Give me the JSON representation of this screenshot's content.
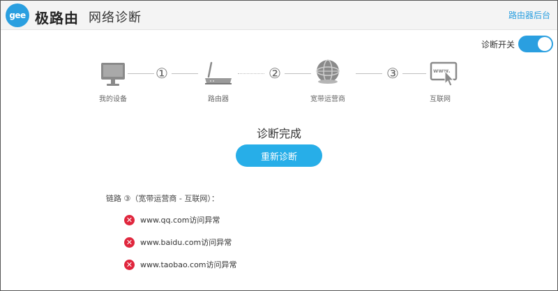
{
  "header": {
    "logo_text": "gee",
    "brand": "极路由",
    "title": "网络诊断",
    "admin_link": "路由器后台"
  },
  "toggle": {
    "label": "诊断开关",
    "on": true
  },
  "steps": [
    {
      "label": "我的设备",
      "icon": "monitor-icon"
    },
    {
      "label": "路由器",
      "icon": "router-icon"
    },
    {
      "label": "宽带运营商",
      "icon": "globe-icon"
    },
    {
      "label": "互联网",
      "icon": "www-icon"
    }
  ],
  "step_numbers": [
    "①",
    "②",
    "③"
  ],
  "status": {
    "title": "诊断完成",
    "redo_button": "重新诊断"
  },
  "link_summary": "链路 ③（宽带运营商 - 互联网）：",
  "results": [
    {
      "text": "www.qq.com访问异常",
      "status": "error"
    },
    {
      "text": "www.baidu.com访问异常",
      "status": "error"
    },
    {
      "text": "www.taobao.com访问异常",
      "status": "error"
    }
  ],
  "colors": {
    "accent": "#2a9fe0",
    "error": "#e0263d"
  }
}
